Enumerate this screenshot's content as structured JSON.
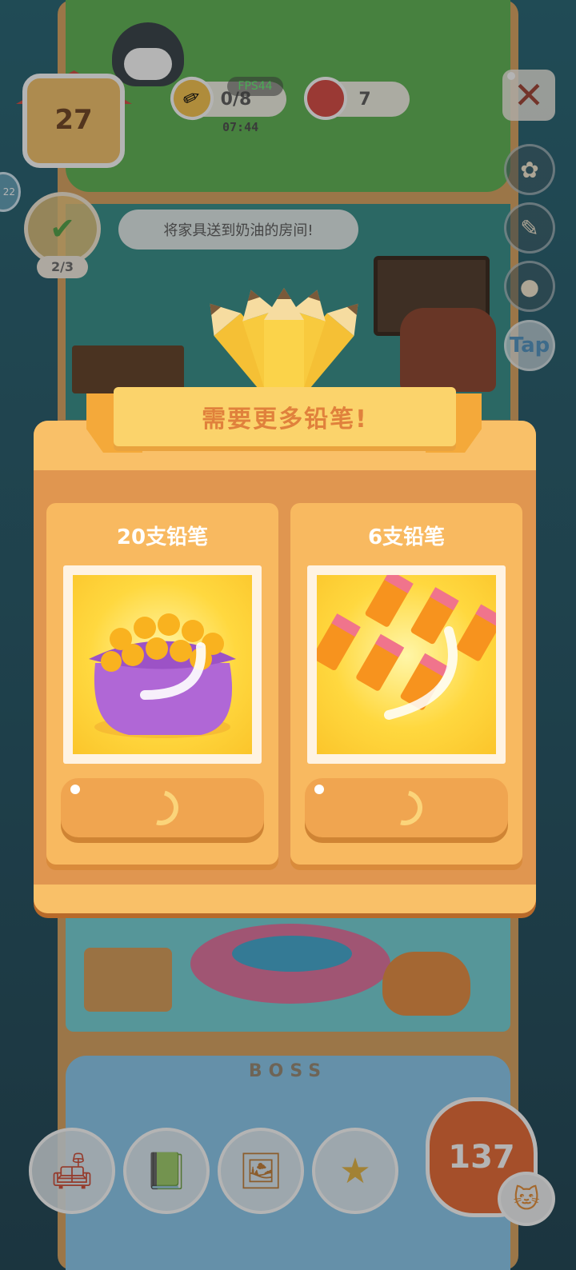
{
  "hud": {
    "house_level": "27",
    "pencils": "0/8",
    "cans": "7",
    "fps": "FPS44",
    "timer": "07:44",
    "close_label": "✕",
    "side_badge": "22"
  },
  "side_buttons": {
    "gear": "✿",
    "brush": "✎",
    "stamp": "●",
    "tap": "Tap"
  },
  "task": {
    "progress": "2/3",
    "message": "将家具送到奶油的房间!",
    "check_icon": "✔"
  },
  "scene": {
    "boss_label": "BOSS"
  },
  "dock": {
    "coins": "137",
    "sofa_icon": "sofa-icon",
    "book_icon": "book-icon",
    "frame_icon": "picture-frame-icon",
    "trophy_icon": "trophy-icon",
    "cat_icon": "cat-icon"
  },
  "modal": {
    "title": "需要更多铅笔!",
    "offers": [
      {
        "title": "20支铅笔",
        "image": "pencil-bag-icon"
      },
      {
        "title": "6支铅笔",
        "image": "six-pencils-icon"
      }
    ]
  },
  "colors": {
    "modal_bg": "#e09650",
    "card_bg": "#f8b960",
    "ribbon": "#fbd36b",
    "title_text": "#e0813c"
  }
}
